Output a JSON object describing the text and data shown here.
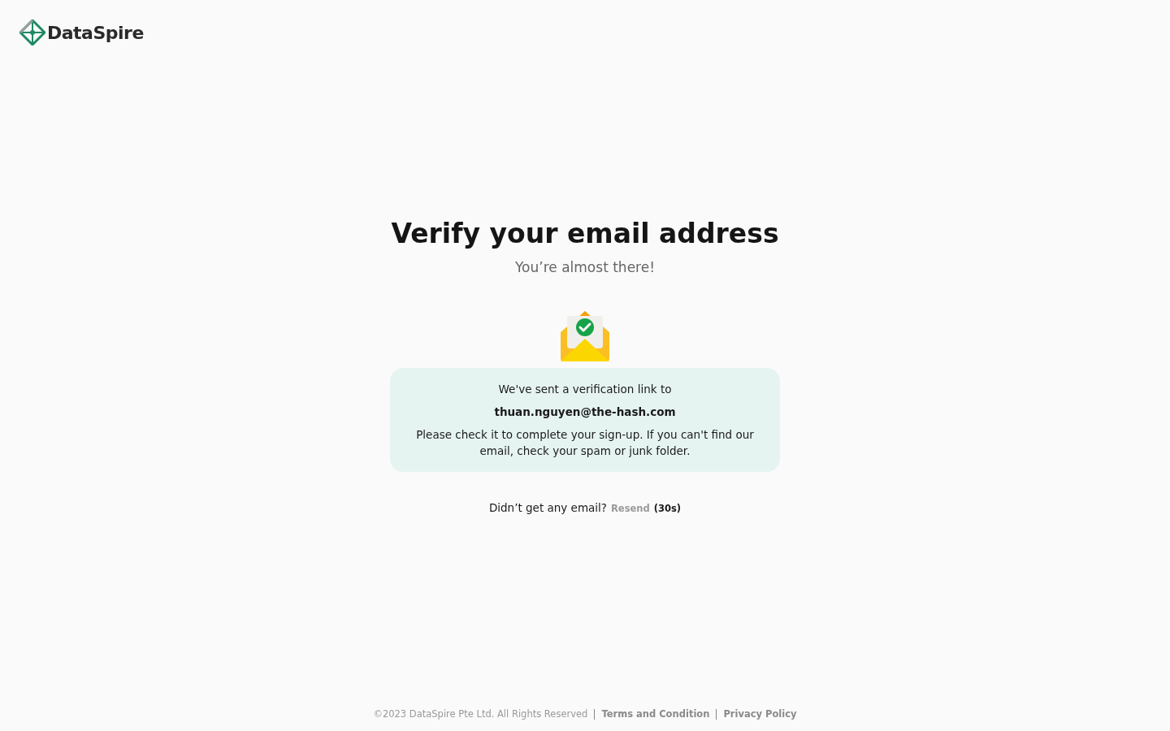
{
  "header": {
    "logo_text": "DataSpire"
  },
  "main": {
    "title": "Verify your email address",
    "subtitle": "You’re almost there!",
    "notice": {
      "intro": "We've sent a verification link to",
      "email": "thuan.nguyen@the-hash.com",
      "body": "Please check it to complete your sign-up. If you can't find our email, check your spam or junk folder."
    },
    "resend": {
      "prompt": "Didn’t get any email?",
      "link": "Resend",
      "disabled": true,
      "countdown": "(30s)"
    }
  },
  "footer": {
    "copyright": "©2023 DataSpire Pte Ltd. All Rights Reserved",
    "links": [
      "Terms and Condition",
      "Privacy Policy"
    ]
  }
}
